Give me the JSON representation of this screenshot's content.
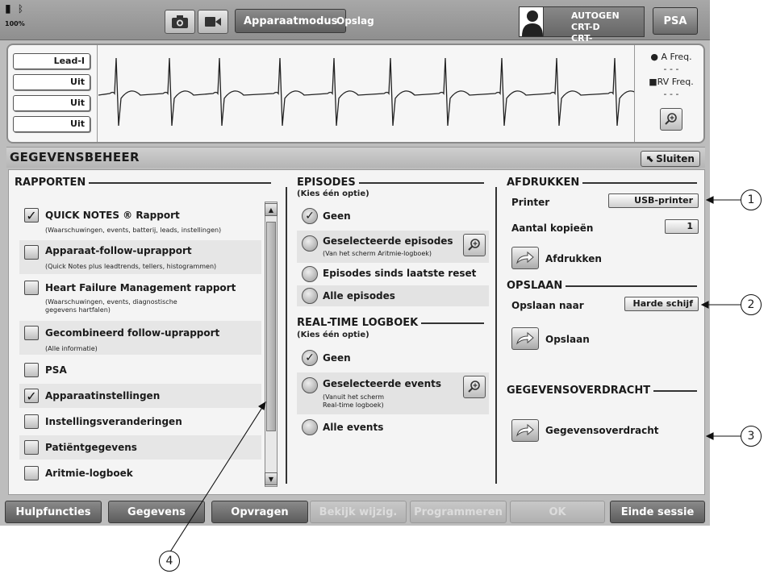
{
  "status": {
    "battery_pct": "100%"
  },
  "topbar": {
    "mode_button": "Apparaatmodus",
    "mode_label": "Opslag",
    "device_line1": "AUTOGEN CRT-D",
    "device_line2": "CRT-defibrillator",
    "psa_button": "PSA"
  },
  "ecg": {
    "leads": [
      "Lead-I",
      "Uit",
      "Uit",
      "Uit"
    ],
    "a_freq_label": "A Freq.",
    "a_freq_value": "- - -",
    "rv_freq_label": "RV Freq.",
    "rv_freq_value": "- - -"
  },
  "header": {
    "title": "GEGEVENSBEHEER",
    "close_label": "Sluiten"
  },
  "reports": {
    "title": "RAPPORTEN",
    "items": [
      {
        "label": "QUICK NOTES ® Rapport",
        "sub": "(Waarschuwingen, events, batterij, leads, instellingen)",
        "checked": "✓"
      },
      {
        "label": "Apparaat-follow-uprapport",
        "sub": "(Quick Notes plus leadtrends, tellers, histogrammen)",
        "checked": ""
      },
      {
        "label": "Heart Failure Management rapport",
        "sub": "(Waarschuwingen, events, diagnostische",
        "sub2": "gegevens hartfalen)",
        "checked": ""
      },
      {
        "label": "Gecombineerd follow-uprapport",
        "sub": "(Alle informatie)",
        "checked": ""
      },
      {
        "label": "PSA",
        "sub": "",
        "checked": ""
      },
      {
        "label": "Apparaatinstellingen",
        "sub": "",
        "checked": "✓"
      },
      {
        "label": "Instellingsveranderingen",
        "sub": "",
        "checked": ""
      },
      {
        "label": "Patiëntgegevens",
        "sub": "",
        "checked": ""
      },
      {
        "label": "Aritmie-logboek",
        "sub": "",
        "checked": ""
      }
    ]
  },
  "episodes": {
    "title": "EPISODES",
    "hint": "(Kies één optie)",
    "options": [
      {
        "label": "Geen",
        "sub": "",
        "selected": "✓"
      },
      {
        "label": "Geselecteerde episodes",
        "sub": "(Van het scherm Aritmie-logboek)",
        "selected": ""
      },
      {
        "label": "Episodes sinds laatste reset",
        "sub": "",
        "selected": ""
      },
      {
        "label": "Alle episodes",
        "sub": "",
        "selected": ""
      }
    ]
  },
  "realtime": {
    "title": "REAL-TIME LOGBOEK",
    "hint": "(Kies één optie)",
    "options": [
      {
        "label": "Geen",
        "sub": "",
        "selected": "✓"
      },
      {
        "label": "Geselecteerde events",
        "sub": "(Vanuit het scherm",
        "sub2": "Real-time logboek)",
        "selected": ""
      },
      {
        "label": "Alle events",
        "sub": "",
        "selected": ""
      }
    ]
  },
  "print": {
    "title": "AFDRUKKEN",
    "printer_label": "Printer",
    "printer_value": "USB-printer",
    "copies_label": "Aantal kopieën",
    "copies_value": "1",
    "action_label": "Afdrukken"
  },
  "save": {
    "title": "OPSLAAN",
    "target_label": "Opslaan naar",
    "target_value": "Harde schijf",
    "action_label": "Opslaan"
  },
  "transfer": {
    "title": "GEGEVENSOVERDRACHT",
    "action_label": "Gegevensoverdracht"
  },
  "bottom": {
    "buttons": [
      "Hulpfuncties",
      "Gegevens",
      "Opvragen",
      "Bekijk wijzig.",
      "Programmeren",
      "OK",
      "Einde sessie"
    ]
  },
  "callouts": [
    "1",
    "2",
    "3",
    "4"
  ]
}
